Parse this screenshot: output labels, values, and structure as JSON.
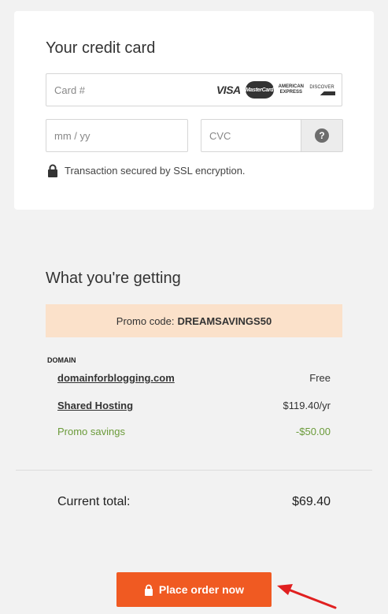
{
  "card_section": {
    "title": "Your credit card",
    "card_number_placeholder": "Card #",
    "brands": {
      "visa": "VISA",
      "mastercard": "MasterCard",
      "amex": "AMERICAN EXPRESS",
      "discover": "DISCOVER"
    },
    "expiry_placeholder": "mm / yy",
    "cvc_placeholder": "CVC",
    "cvc_help_icon": "?",
    "ssl_text": "Transaction secured by SSL encryption."
  },
  "summary": {
    "title": "What you're getting",
    "promo_label": "Promo code:",
    "promo_code": "DREAMSAVINGS50",
    "domain_label": "DOMAIN",
    "items": [
      {
        "name": "domainforblogging.com",
        "price": "Free"
      },
      {
        "name": "Shared Hosting",
        "price": "$119.40/yr"
      }
    ],
    "savings": {
      "name": "Promo savings",
      "price": "-$50.00"
    },
    "total_label": "Current total:",
    "total_value": "$69.40"
  },
  "order_button": {
    "label": "Place order now"
  },
  "colors": {
    "accent": "#f05a22",
    "promo_bg": "#fbe1ca",
    "savings": "#6b9b3a",
    "annotation_arrow": "#e02020"
  },
  "icons": [
    "lock-icon",
    "question-mark-icon",
    "red-arrow-annotation"
  ]
}
